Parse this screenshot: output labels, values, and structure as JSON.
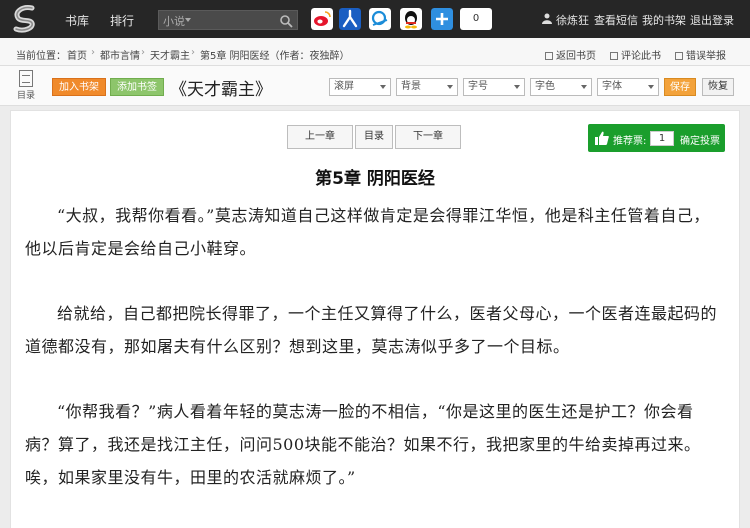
{
  "topbar": {
    "nav": [
      {
        "label": "书库"
      },
      {
        "label": "排行"
      }
    ],
    "search": {
      "scope": "小说"
    },
    "share_count": "0",
    "user_links": [
      {
        "label": "徐炼狂"
      },
      {
        "label": "查看短信"
      },
      {
        "label": "我的书架"
      },
      {
        "label": "退出登录"
      }
    ]
  },
  "breadcrumb": {
    "prefix": "当前位置：",
    "items": [
      "首页",
      "都市言情",
      "天才霸主",
      "第5章  阴阳医经（作者：夜独醉）"
    ],
    "links": [
      "返回书页",
      "评论此书",
      "错误举报"
    ]
  },
  "toolbar": {
    "toc_label": "目录",
    "add_shelf": "加入书架",
    "add_bookmark": "添加书签",
    "book_title": "《天才霸主》",
    "selects": [
      "滚屏",
      "背景",
      "字号",
      "字色",
      "字体"
    ],
    "save": "保存",
    "restore": "恢复"
  },
  "chapter_nav": {
    "prev": "上一章",
    "toc": "目录",
    "next": "下一章"
  },
  "vote": {
    "label": "推荐票:",
    "value": "1",
    "confirm": "确定投票"
  },
  "chapter": {
    "title": "第5章 阴阳医经",
    "paragraphs": [
      "“大叔，我帮你看看。”莫志涛知道自己这样做肯定是会得罪江华恒，他是科主任管着自己，他以后肯定是会给自己小鞋穿。",
      "给就给，自己都把院长得罪了，一个主任又算得了什么，医者父母心，一个医者连最起码的道德都没有，那如屠夫有什么区别？想到这里，莫志涛似乎多了一个目标。",
      "“你帮我看？”病人看着年轻的莫志涛一脸的不相信，“你是这里的医生还是护工？你会看病？算了，我还是找江主任，问问500块能不能治？如果不行，我把家里的牛给卖掉再过来。唉，如果家里没有牛，田里的农活就麻烦了。”"
    ]
  },
  "colors": {
    "topbar_bg": "#262626",
    "add_shelf_bg": "#f08a2b",
    "add_bookmark_bg": "#8dc56b",
    "vote_bg": "#1a9e2c"
  }
}
